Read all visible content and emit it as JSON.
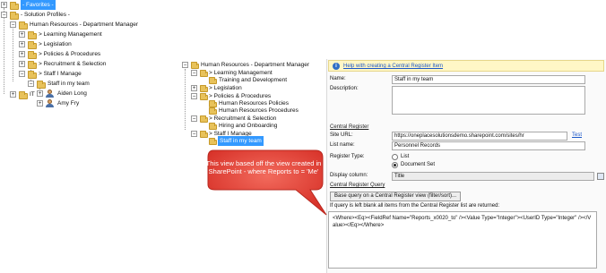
{
  "left_tree": {
    "favorites": "- Favorites -",
    "solution_profiles": "- Solution Profiles -",
    "hr_dept_manager": "Human Resources - Department Manager",
    "learning_management": "> Learning Management",
    "legislation": "> Legislation",
    "policies": "> Policies & Procedures",
    "recruitment": "> Recruitment & Selection",
    "staff_i_manage": "> Staff I Manage",
    "staff_in_my_team": "Staff in my team",
    "aiden": "Aiden Long",
    "amy": "Amy Fry",
    "it": "IT"
  },
  "middle_tree": {
    "hr_dept_manager": "Human Resources - Department Manager",
    "learning_management": "> Learning Management",
    "training": "Training and Development",
    "legislation": "> Legislation",
    "policies": "> Policies & Procedures",
    "hr_policies": "Human Resources Policies",
    "hr_procedures": "Human Resources Procedures",
    "recruitment": "> Recruitment & Selection",
    "hiring": "Hiring and Onboarding",
    "staff_i_manage": "> Staff I Manage",
    "staff_in_my_team": "Staff in my team"
  },
  "form": {
    "help_link": "Help with creating a Central Register Item",
    "name_label": "Name:",
    "name_value": "Staff in my team",
    "description_label": "Description:",
    "central_register_heading": "Central Register",
    "site_url_label": "Site URL:",
    "site_url_value": "https://oneplacesolutionsdemo.sharepoint.com/sites/hr",
    "test_link": "Test",
    "list_name_label": "List name:",
    "list_name_value": "Personnel Records",
    "register_type_label": "Register Type:",
    "option_list": "List",
    "option_document_set": "Document Set",
    "display_column_label": "Display column:",
    "display_column_value": "Title",
    "query_heading": "Central Register Query",
    "base_query_button": "Base query on a Central Register view (filter/sort)...",
    "query_hint": "If query is left blank all items from the Central Register list are returned:",
    "query_text": "<Where><Eq><FieldRef Name=\"Reports_x0020_to\" /><Value Type=\"Integer\"><UserID Type=\"Integer\" /></Value></Eq></Where>"
  },
  "callout": {
    "text": "This view based off the view created in SharePoint - where Reports to = 'Me'"
  },
  "colors": {
    "selection": "#3399ff",
    "callout_fill": "#e8463a",
    "help_bar": "#fff7c6"
  }
}
